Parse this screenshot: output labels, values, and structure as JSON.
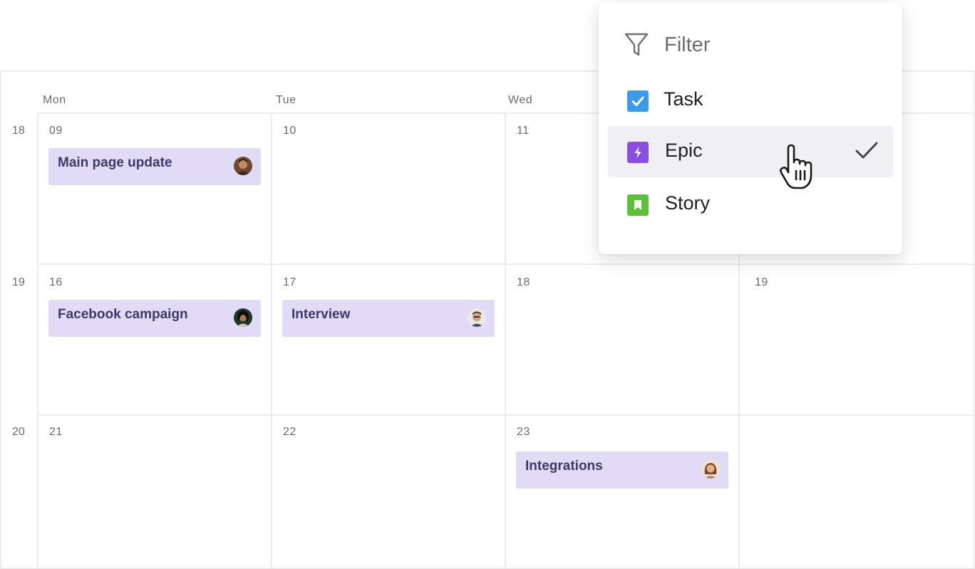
{
  "weekdays": [
    "Mon",
    "Tue",
    "Wed"
  ],
  "weeks": [
    {
      "number": "18",
      "dates": [
        "09",
        "10",
        "11"
      ]
    },
    {
      "number": "19",
      "dates": [
        "16",
        "17",
        "18",
        "19"
      ]
    },
    {
      "number": "20",
      "dates": [
        "21",
        "22",
        "23"
      ]
    }
  ],
  "events": {
    "main_page_update": "Main page update",
    "facebook_campaign": "Facebook campaign",
    "interview": "Interview",
    "integrations": "Integrations"
  },
  "filter": {
    "title": "Filter",
    "options": [
      {
        "label": "Task",
        "icon": "task-icon",
        "color": "#3d9ae8",
        "selected": false
      },
      {
        "label": "Epic",
        "icon": "epic-icon",
        "color": "#8b4fe0",
        "selected": true
      },
      {
        "label": "Story",
        "icon": "story-icon",
        "color": "#5fbe3a",
        "selected": false
      }
    ]
  },
  "colors": {
    "event_bg": "#e2dbf5",
    "event_text": "#3c3a6a",
    "grid": "#ececec"
  }
}
